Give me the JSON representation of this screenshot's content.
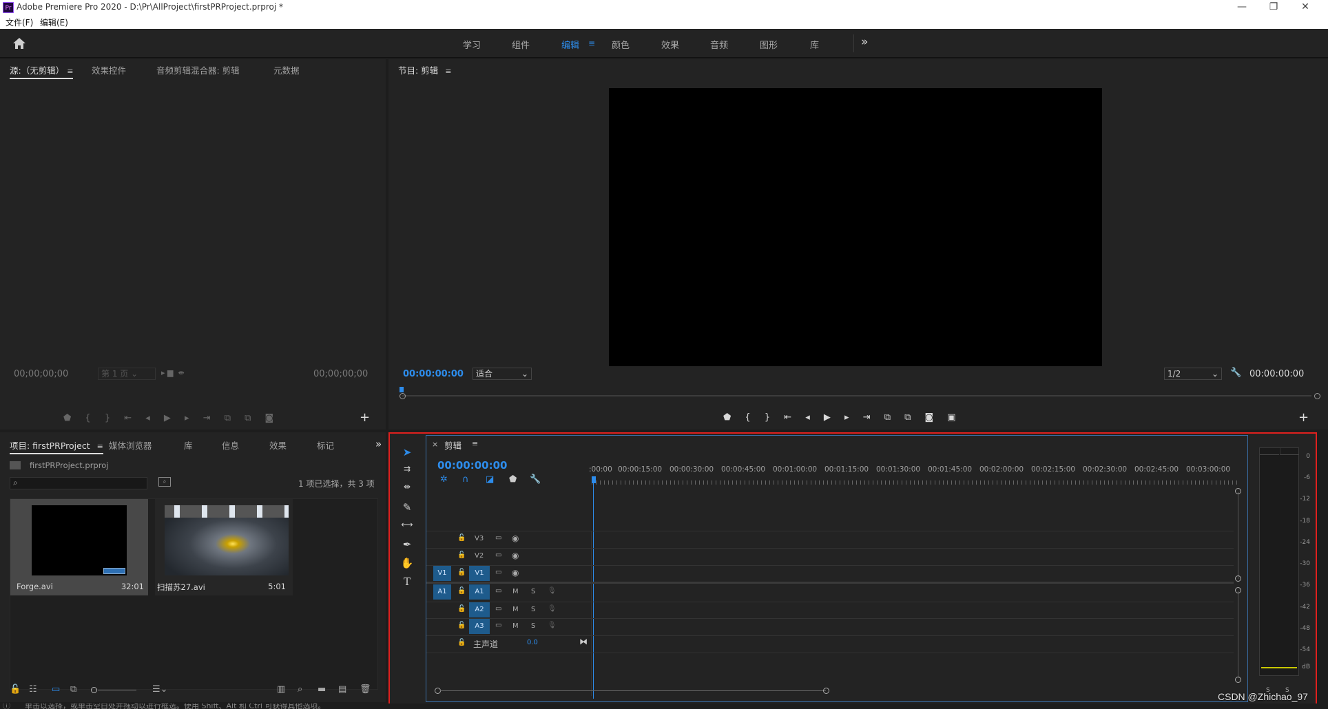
{
  "window": {
    "logo": "Pr",
    "title": "Adobe Premiere Pro 2020 - D:\\Pr\\AllProject\\firstPRProject.prproj *",
    "minimize": "—",
    "restore": "❐",
    "close": "✕"
  },
  "menu": [
    "文件(F)",
    "编辑(E)"
  ],
  "workspaces": {
    "items": [
      "学习",
      "组件",
      "编辑",
      "颜色",
      "效果",
      "音频",
      "图形",
      "库"
    ],
    "active": "编辑",
    "active_menu": "≡",
    "more": "»"
  },
  "source_panel": {
    "tabs": [
      "源:（无剪辑）",
      "效果控件",
      "音频剪辑混合器: 剪辑",
      "元数据"
    ],
    "tab_menu": "≡",
    "timecode_left": "00;00;00;00",
    "timecode_right": "00;00;00;00",
    "page_select": "第 1 页",
    "add": "+"
  },
  "program_panel": {
    "title": "节目: 剪辑",
    "title_menu": "≡",
    "timecode": "00:00:00:00",
    "fit": "适合",
    "resolution": "1/2",
    "timecode_right": "00:00:00:00",
    "add": "+"
  },
  "project_panel": {
    "tabs": [
      "项目: firstPRProject",
      "媒体浏览器",
      "库",
      "信息",
      "效果",
      "标记"
    ],
    "tab_menu": "≡",
    "more": "»",
    "project_file": "firstPRProject.prproj",
    "search_placeholder": "",
    "selection_info": "1 项已选择，共 3 项",
    "items": [
      {
        "name": "Forge.avi",
        "duration": "32:01"
      },
      {
        "name": "扫描苏27.avi",
        "duration": "5:01"
      }
    ]
  },
  "timeline": {
    "close": "×",
    "title": "剪辑",
    "title_menu": "≡",
    "timecode": "00:00:00:00",
    "ruler": [
      ":00:00",
      "00:00:15:00",
      "00:00:30:00",
      "00:00:45:00",
      "00:01:00:00",
      "00:01:15:00",
      "00:01:30:00",
      "00:01:45:00",
      "00:02:00:00",
      "00:02:15:00",
      "00:02:30:00",
      "00:02:45:00",
      "00:03:00:00"
    ],
    "video_tracks": [
      {
        "label": "V3",
        "source": ""
      },
      {
        "label": "V2",
        "source": ""
      },
      {
        "label": "V1",
        "source": "V1"
      }
    ],
    "audio_tracks": [
      {
        "label": "A1",
        "source": "A1"
      },
      {
        "label": "A2",
        "source": ""
      },
      {
        "label": "A3",
        "source": ""
      }
    ],
    "track_buttons": {
      "mute": "M",
      "solo": "S"
    },
    "master": {
      "label": "主声道",
      "value": "0.0"
    }
  },
  "audio_meter": {
    "scale": [
      "0",
      "-6",
      "-12",
      "-18",
      "-24",
      "-30",
      "-36",
      "-42",
      "-48",
      "-54",
      "dB"
    ],
    "solo": [
      "S",
      "S"
    ]
  },
  "status_bar": {
    "hint": "单击以选择，或单击空白处并拖动以进行框选。使用 Shift、Alt 和 Ctrl 可获得其他选项。"
  },
  "watermark": "CSDN @Zhichao_97",
  "colors": {
    "accent": "#2d8ceb",
    "highlight_border": "#e0201e",
    "panel_bg": "#232323"
  }
}
